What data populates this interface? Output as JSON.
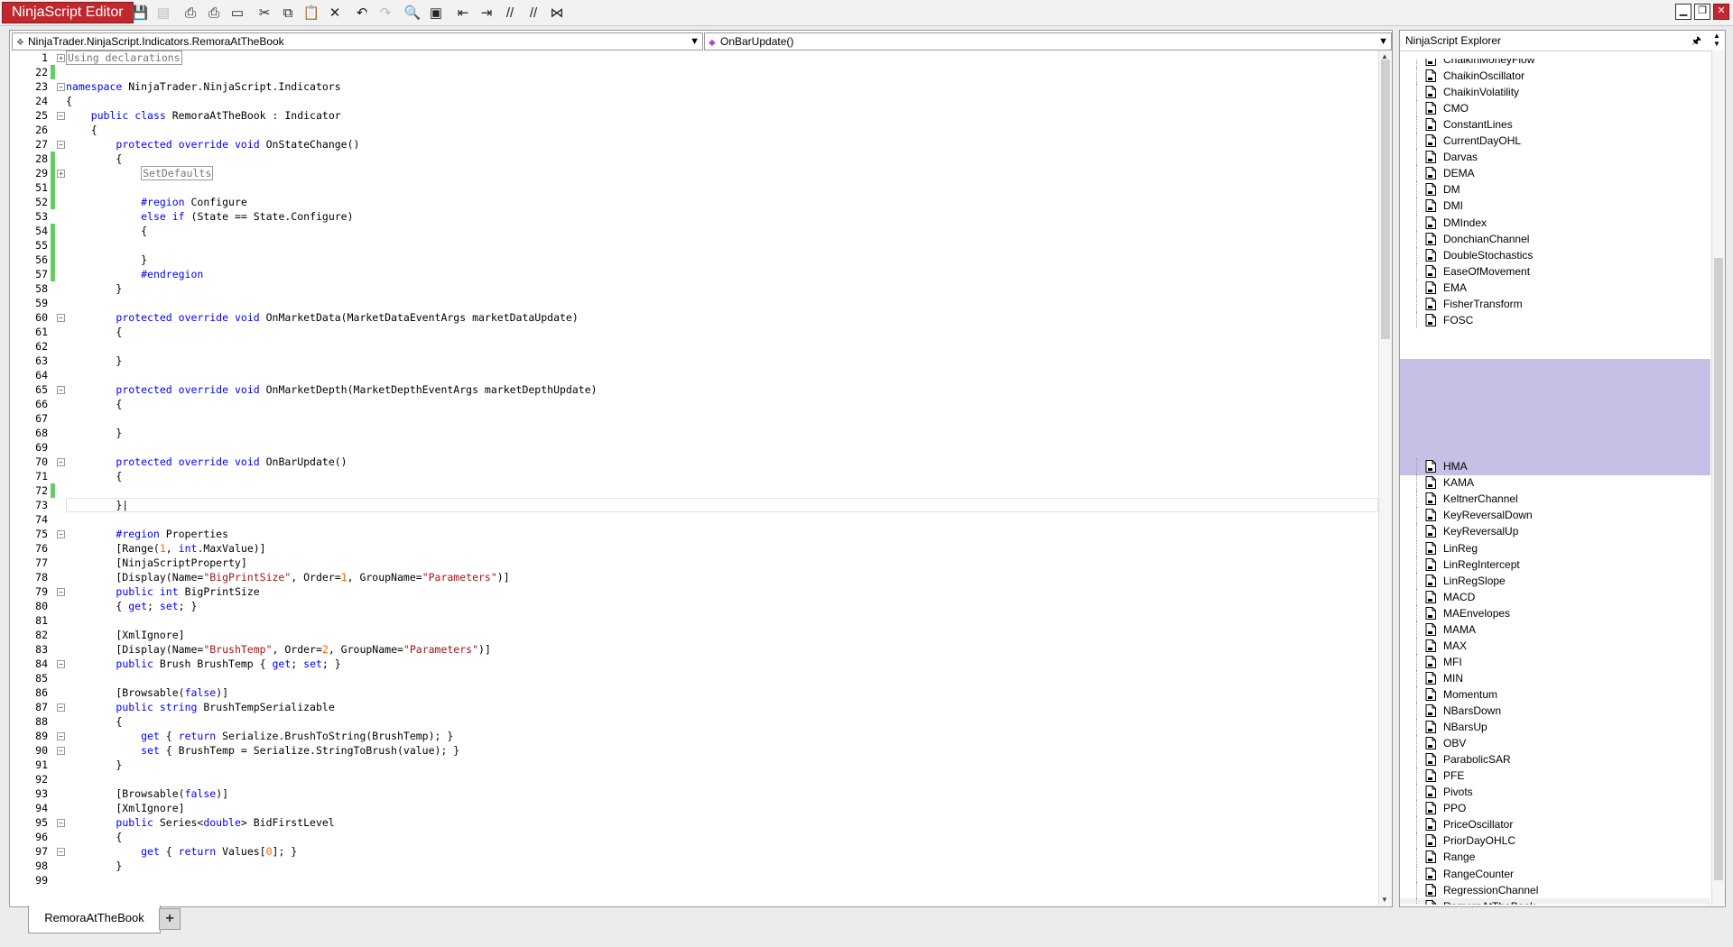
{
  "app": {
    "title": "NinjaScript Editor"
  },
  "toolbar": {
    "buttons": [
      {
        "icon": "save-icon",
        "glyph": "💾",
        "enabled": false
      },
      {
        "icon": "save-all-icon",
        "glyph": "▤",
        "enabled": false
      },
      {
        "icon": "print-icon",
        "glyph": "⎙",
        "enabled": true
      },
      {
        "icon": "print-preview-icon",
        "glyph": "⎙",
        "enabled": true
      },
      {
        "icon": "page-setup-icon",
        "glyph": "▭",
        "enabled": true
      },
      {
        "icon": "cut-icon",
        "glyph": "✂",
        "enabled": true
      },
      {
        "icon": "copy-icon",
        "glyph": "⧉",
        "enabled": true
      },
      {
        "icon": "paste-icon",
        "glyph": "📋",
        "enabled": true
      },
      {
        "icon": "delete-icon",
        "glyph": "✕",
        "enabled": true
      },
      {
        "icon": "undo-icon",
        "glyph": "↶",
        "enabled": true
      },
      {
        "icon": "redo-icon",
        "glyph": "↷",
        "enabled": false
      },
      {
        "icon": "find-icon",
        "glyph": "🔍",
        "enabled": true
      },
      {
        "icon": "compile-icon",
        "glyph": "▣",
        "enabled": true
      },
      {
        "icon": "outdent-icon",
        "glyph": "⇤",
        "enabled": true
      },
      {
        "icon": "indent-icon",
        "glyph": "⇥",
        "enabled": true
      },
      {
        "icon": "comment-icon",
        "glyph": "//",
        "enabled": true
      },
      {
        "icon": "uncomment-icon",
        "glyph": "//",
        "enabled": true
      },
      {
        "icon": "visual-studio-icon",
        "glyph": "⋈",
        "enabled": true
      }
    ]
  },
  "window_controls": {
    "minimize": "▁",
    "restore": "❐",
    "close": "✕"
  },
  "editor": {
    "class_selector": "NinjaTrader.NinjaScript.Indicators.RemoraAtTheBook",
    "member_selector": "OnBarUpdate()",
    "lines": [
      {
        "n": "1",
        "fold": "+",
        "chg": false,
        "html": "<span class=\"collapsed\">Using declarations</span>"
      },
      {
        "n": "22",
        "fold": "",
        "chg": true,
        "html": ""
      },
      {
        "n": "23",
        "fold": "-",
        "chg": false,
        "html": "<span class=\"kw\">namespace</span> NinjaTrader.NinjaScript.Indicators"
      },
      {
        "n": "24",
        "fold": "",
        "chg": false,
        "html": "{"
      },
      {
        "n": "25",
        "fold": "-",
        "chg": false,
        "html": "    <span class=\"kw\">public</span> <span class=\"kw\">class</span> RemoraAtTheBook : Indicator"
      },
      {
        "n": "26",
        "fold": "",
        "chg": false,
        "html": "    {"
      },
      {
        "n": "27",
        "fold": "-",
        "chg": false,
        "html": "        <span class=\"kw\">protected</span> <span class=\"kw\">override</span> <span class=\"kw\">void</span> OnStateChange()"
      },
      {
        "n": "28",
        "fold": "",
        "chg": true,
        "html": "        {"
      },
      {
        "n": "29",
        "fold": "+",
        "chg": true,
        "html": "            <span class=\"collapsed\">SetDefaults</span>"
      },
      {
        "n": "51",
        "fold": "",
        "chg": true,
        "html": ""
      },
      {
        "n": "52",
        "fold": "",
        "chg": true,
        "html": "            <span class=\"kw\">#region</span> Configure"
      },
      {
        "n": "53",
        "fold": "",
        "chg": false,
        "html": "            <span class=\"kw\">else</span> <span class=\"kw\">if</span> (State == State.Configure)"
      },
      {
        "n": "54",
        "fold": "",
        "chg": true,
        "html": "            {"
      },
      {
        "n": "55",
        "fold": "",
        "chg": true,
        "html": ""
      },
      {
        "n": "56",
        "fold": "",
        "chg": true,
        "html": "            }"
      },
      {
        "n": "57",
        "fold": "",
        "chg": true,
        "html": "            <span class=\"kw\">#endregion</span>"
      },
      {
        "n": "58",
        "fold": "",
        "chg": false,
        "html": "        }"
      },
      {
        "n": "59",
        "fold": "",
        "chg": false,
        "html": ""
      },
      {
        "n": "60",
        "fold": "-",
        "chg": false,
        "html": "        <span class=\"kw\">protected</span> <span class=\"kw\">override</span> <span class=\"kw\">void</span> OnMarketData(MarketDataEventArgs marketDataUpdate)"
      },
      {
        "n": "61",
        "fold": "",
        "chg": false,
        "html": "        {"
      },
      {
        "n": "62",
        "fold": "",
        "chg": false,
        "html": ""
      },
      {
        "n": "63",
        "fold": "",
        "chg": false,
        "html": "        }"
      },
      {
        "n": "64",
        "fold": "",
        "chg": false,
        "html": ""
      },
      {
        "n": "65",
        "fold": "-",
        "chg": false,
        "html": "        <span class=\"kw\">protected</span> <span class=\"kw\">override</span> <span class=\"kw\">void</span> OnMarketDepth(MarketDepthEventArgs marketDepthUpdate)"
      },
      {
        "n": "66",
        "fold": "",
        "chg": false,
        "html": "        {"
      },
      {
        "n": "67",
        "fold": "",
        "chg": false,
        "html": ""
      },
      {
        "n": "68",
        "fold": "",
        "chg": false,
        "html": "        }"
      },
      {
        "n": "69",
        "fold": "",
        "chg": false,
        "html": ""
      },
      {
        "n": "70",
        "fold": "-",
        "chg": false,
        "html": "        <span class=\"kw\">protected</span> <span class=\"kw\">override</span> <span class=\"kw\">void</span> OnBarUpdate()"
      },
      {
        "n": "71",
        "fold": "",
        "chg": false,
        "html": "        {"
      },
      {
        "n": "72",
        "fold": "",
        "chg": true,
        "html": ""
      },
      {
        "n": "73",
        "fold": "",
        "chg": false,
        "html": "        }|",
        "current": true
      },
      {
        "n": "74",
        "fold": "",
        "chg": false,
        "html": ""
      },
      {
        "n": "75",
        "fold": "-",
        "chg": false,
        "html": "        <span class=\"kw\">#region</span> Properties"
      },
      {
        "n": "76",
        "fold": "",
        "chg": false,
        "html": "        [Range(<span class=\"nu\">1</span>, <span class=\"kw\">int</span>.MaxValue)]"
      },
      {
        "n": "77",
        "fold": "",
        "chg": false,
        "html": "        [NinjaScriptProperty]"
      },
      {
        "n": "78",
        "fold": "",
        "chg": false,
        "html": "        [Display(Name=<span class=\"st\">\"BigPrintSize\"</span>, Order=<span class=\"nu\">1</span>, GroupName=<span class=\"st\">\"Parameters\"</span>)]"
      },
      {
        "n": "79",
        "fold": "-",
        "chg": false,
        "html": "        <span class=\"kw\">public</span> <span class=\"kw\">int</span> BigPrintSize"
      },
      {
        "n": "80",
        "fold": "",
        "chg": false,
        "html": "        { <span class=\"kw\">get</span>; <span class=\"kw\">set</span>; }"
      },
      {
        "n": "81",
        "fold": "",
        "chg": false,
        "html": ""
      },
      {
        "n": "82",
        "fold": "",
        "chg": false,
        "html": "        [XmlIgnore]"
      },
      {
        "n": "83",
        "fold": "",
        "chg": false,
        "html": "        [Display(Name=<span class=\"st\">\"BrushTemp\"</span>, Order=<span class=\"nu\">2</span>, GroupName=<span class=\"st\">\"Parameters\"</span>)]"
      },
      {
        "n": "84",
        "fold": "-",
        "chg": false,
        "html": "        <span class=\"kw\">public</span> Brush BrushTemp { <span class=\"kw\">get</span>; <span class=\"kw\">set</span>; }"
      },
      {
        "n": "85",
        "fold": "",
        "chg": false,
        "html": ""
      },
      {
        "n": "86",
        "fold": "",
        "chg": false,
        "html": "        [Browsable(<span class=\"kw\">false</span>)]"
      },
      {
        "n": "87",
        "fold": "-",
        "chg": false,
        "html": "        <span class=\"kw\">public</span> <span class=\"kw\">string</span> BrushTempSerializable"
      },
      {
        "n": "88",
        "fold": "",
        "chg": false,
        "html": "        {"
      },
      {
        "n": "89",
        "fold": "-",
        "chg": false,
        "html": "            <span class=\"kw\">get</span> { <span class=\"kw\">return</span> Serialize.BrushToString(BrushTemp); }"
      },
      {
        "n": "90",
        "fold": "-",
        "chg": false,
        "html": "            <span class=\"kw\">set</span> { BrushTemp = Serialize.StringToBrush(value); }"
      },
      {
        "n": "91",
        "fold": "",
        "chg": false,
        "html": "        }"
      },
      {
        "n": "92",
        "fold": "",
        "chg": false,
        "html": ""
      },
      {
        "n": "93",
        "fold": "",
        "chg": false,
        "html": "        [Browsable(<span class=\"kw\">false</span>)]"
      },
      {
        "n": "94",
        "fold": "",
        "chg": false,
        "html": "        [XmlIgnore]"
      },
      {
        "n": "95",
        "fold": "-",
        "chg": false,
        "html": "        <span class=\"kw\">public</span> Series&lt;<span class=\"kw\">double</span>&gt; BidFirstLevel"
      },
      {
        "n": "96",
        "fold": "",
        "chg": false,
        "html": "        {"
      },
      {
        "n": "97",
        "fold": "-",
        "chg": false,
        "html": "            <span class=\"kw\">get</span> { <span class=\"kw\">return</span> Values[<span class=\"nu\">0</span>]; }"
      },
      {
        "n": "98",
        "fold": "",
        "chg": false,
        "html": "        }"
      },
      {
        "n": "99",
        "fold": "",
        "chg": false,
        "html": ""
      }
    ]
  },
  "tabs": {
    "active": "RemoraAtTheBook",
    "add_label": "+"
  },
  "explorer": {
    "title": "NinjaScript Explorer",
    "pin_glyph": "📌",
    "items": [
      "ChaikinMoneyFlow",
      "ChaikinOscillator",
      "ChaikinVolatility",
      "CMO",
      "ConstantLines",
      "CurrentDayOHL",
      "Darvas",
      "DEMA",
      "DM",
      "DMI",
      "DMIndex",
      "DonchianChannel",
      "DoubleStochastics",
      "EaseOfMovement",
      "EMA",
      "FisherTransform",
      "FOSC",
      "",
      "",
      "",
      "",
      "",
      "",
      "",
      "",
      "HMA",
      "KAMA",
      "KeltnerChannel",
      "KeyReversalDown",
      "KeyReversalUp",
      "LinReg",
      "LinRegIntercept",
      "LinRegSlope",
      "MACD",
      "MAEnvelopes",
      "MAMA",
      "MAX",
      "MFI",
      "MIN",
      "Momentum",
      "NBarsDown",
      "NBarsUp",
      "OBV",
      "ParabolicSAR",
      "PFE",
      "Pivots",
      "PPO",
      "PriceOscillator",
      "PriorDayOHLC",
      "Range",
      "RangeCounter",
      "RegressionChannel",
      "RemoraAtTheBook"
    ],
    "selected": "RemoraAtTheBook"
  }
}
